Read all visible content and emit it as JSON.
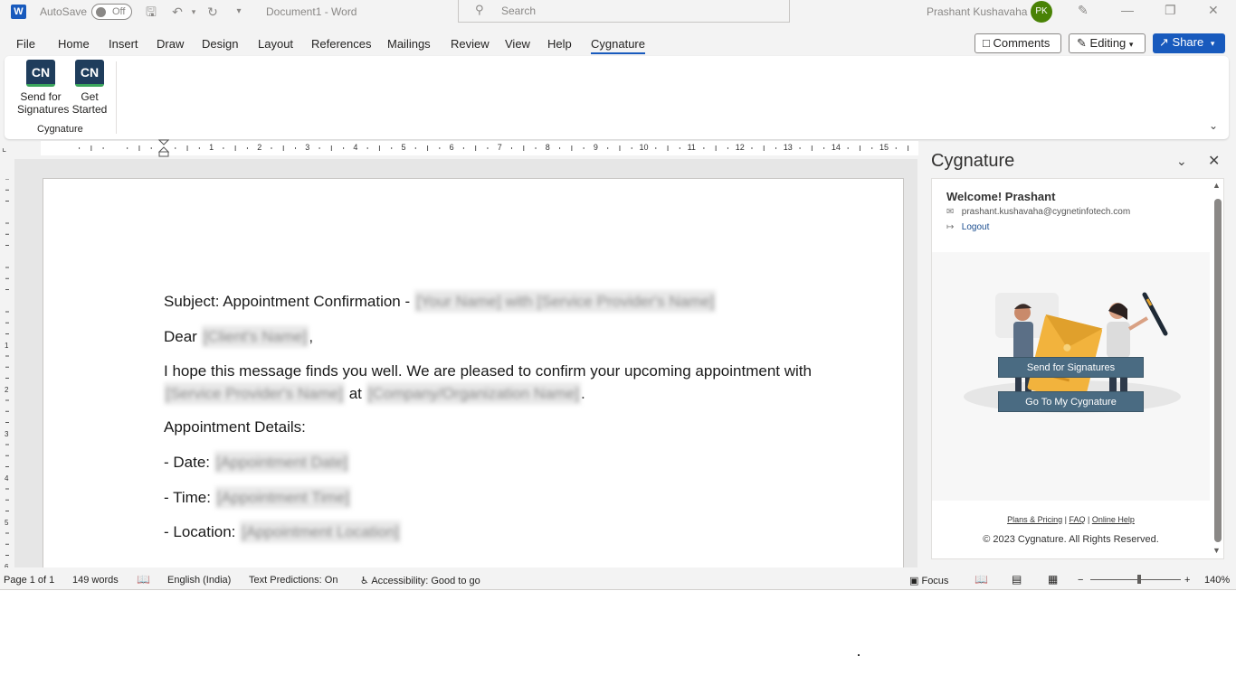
{
  "titlebar": {
    "app_icon": "W",
    "autosave_label": "AutoSave",
    "autosave_state": "Off",
    "doc_title": "Document1 - Word",
    "search_placeholder": "Search",
    "user_name": "Prashant Kushavaha",
    "user_initials": "PK"
  },
  "menu": {
    "items": [
      "File",
      "Home",
      "Insert",
      "Draw",
      "Design",
      "Layout",
      "References",
      "Mailings",
      "Review",
      "View",
      "Help",
      "Cygnature"
    ],
    "active": "Cygnature",
    "comments_label": "Comments",
    "editing_label": "Editing",
    "share_label": "Share"
  },
  "ribbon": {
    "buttons": [
      {
        "logo": "CN",
        "line1": "Send for",
        "line2": "Signatures"
      },
      {
        "logo": "CN",
        "line1": "Get",
        "line2": "Started"
      }
    ],
    "group_label": "Cygnature"
  },
  "ruler": {
    "numbers": [
      "1",
      "2",
      "3",
      "4",
      "5",
      "6",
      "7",
      "8",
      "9",
      "10",
      "11",
      "12",
      "13",
      "14",
      "15"
    ],
    "vnumbers": [
      "1",
      "2",
      "3",
      "4",
      "5",
      "6"
    ]
  },
  "document": {
    "subject_prefix": "Subject: Appointment Confirmation - ",
    "subject_blur": "[Your Name] with [Service Provider's Name]",
    "dear_prefix": "Dear ",
    "dear_blur": "[Client's Name]",
    "dear_suffix": ",",
    "body_line1": "I hope this message finds you well. We are pleased to confirm your upcoming appointment with",
    "body_blur1": "[Service Provider's Name]",
    "body_mid": " at ",
    "body_blur2": "[Company/Organization Name]",
    "body_end": ".",
    "details_heading": "Appointment Details:",
    "date_label": "- Date: ",
    "date_blur": "[Appointment Date]",
    "time_label": "- Time: ",
    "time_blur": "[Appointment Time]",
    "location_label": "- Location: ",
    "location_blur": "[Appointment Location]"
  },
  "pane": {
    "title": "Cygnature",
    "welcome": "Welcome! Prashant",
    "email": "prashant.kushavaha@cygnetinfotech.com",
    "logout": "Logout",
    "send_button": "Send for Signatures",
    "goto_button": "Go To My Cygnature",
    "link_plans": "Plans & Pricing",
    "link_faq": "FAQ",
    "link_help": "Online Help",
    "link_sep": " | ",
    "copyright": "© 2023 Cygnature. All Rights Reserved."
  },
  "statusbar": {
    "page": "Page 1 of 1",
    "words": "149 words",
    "language": "English (India)",
    "predictions": "Text Predictions: On",
    "accessibility": "Accessibility: Good to go",
    "focus": "Focus",
    "zoom_minus": "−",
    "zoom_plus": "+",
    "zoom_level": "140%"
  },
  "colors": {
    "accent": "#185abd",
    "pane_button": "#4a6b82",
    "avatar": "#498205",
    "cygnature_logo": "#1f3d5c"
  }
}
